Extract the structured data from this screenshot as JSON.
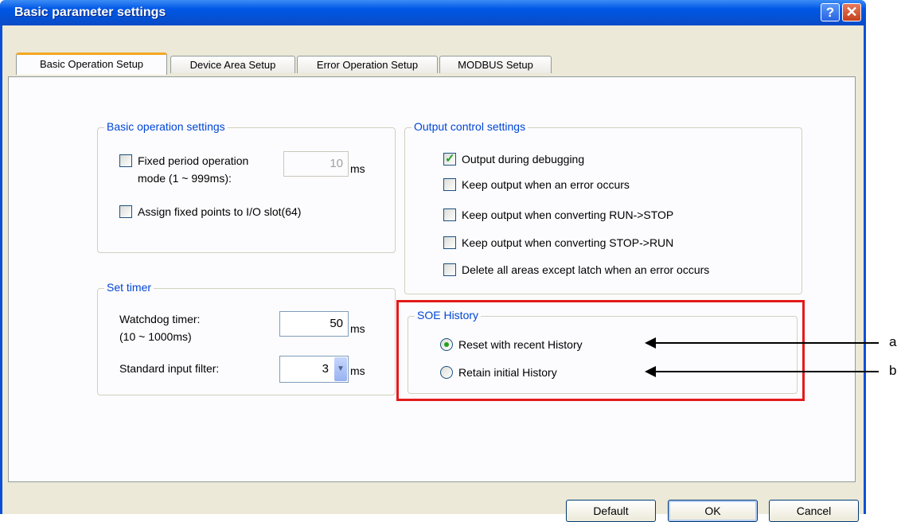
{
  "window": {
    "title": "Basic parameter settings",
    "help_glyph": "?",
    "close_glyph": "✕"
  },
  "tabs": [
    {
      "label": "Basic Operation Setup"
    },
    {
      "label": "Device Area Setup"
    },
    {
      "label": "Error Operation Setup"
    },
    {
      "label": "MODBUS Setup"
    }
  ],
  "basic_operation": {
    "legend": "Basic operation settings",
    "fixed_period_label_1": "Fixed period operation",
    "fixed_period_label_2": "mode (1 ~ 999ms):",
    "fixed_period_value": "10",
    "fixed_period_unit": "ms",
    "assign_fixed_points_label": "Assign fixed points to I/O slot(64)"
  },
  "output_control": {
    "legend": "Output control settings",
    "options": [
      {
        "label": "Output during debugging",
        "checked": true
      },
      {
        "label": "Keep output when an error occurs",
        "checked": false
      },
      {
        "label": "Keep output when converting RUN->STOP",
        "checked": false
      },
      {
        "label": "Keep output when converting STOP->RUN",
        "checked": false
      },
      {
        "label": "Delete all areas except latch when an error occurs",
        "checked": false
      }
    ]
  },
  "set_timer": {
    "legend": "Set timer",
    "watchdog_label_1": "Watchdog timer:",
    "watchdog_label_2": "(10 ~ 1000ms)",
    "watchdog_value": "50",
    "watchdog_unit": "ms",
    "input_filter_label": "Standard input filter:",
    "input_filter_value": "3",
    "input_filter_unit": "ms"
  },
  "soe_history": {
    "legend": "SOE History",
    "options": [
      {
        "label": "Reset with recent History",
        "selected": true
      },
      {
        "label": "Retain initial History",
        "selected": false
      }
    ]
  },
  "callouts": {
    "a": "a",
    "b": "b"
  },
  "buttons": {
    "default": "Default",
    "ok": "OK",
    "cancel": "Cancel"
  },
  "colors": {
    "title_bar": "#0058e6",
    "legend_text": "#0046d5",
    "highlight_box": "#e31b1b",
    "active_tab_accent": "#f5a623"
  }
}
